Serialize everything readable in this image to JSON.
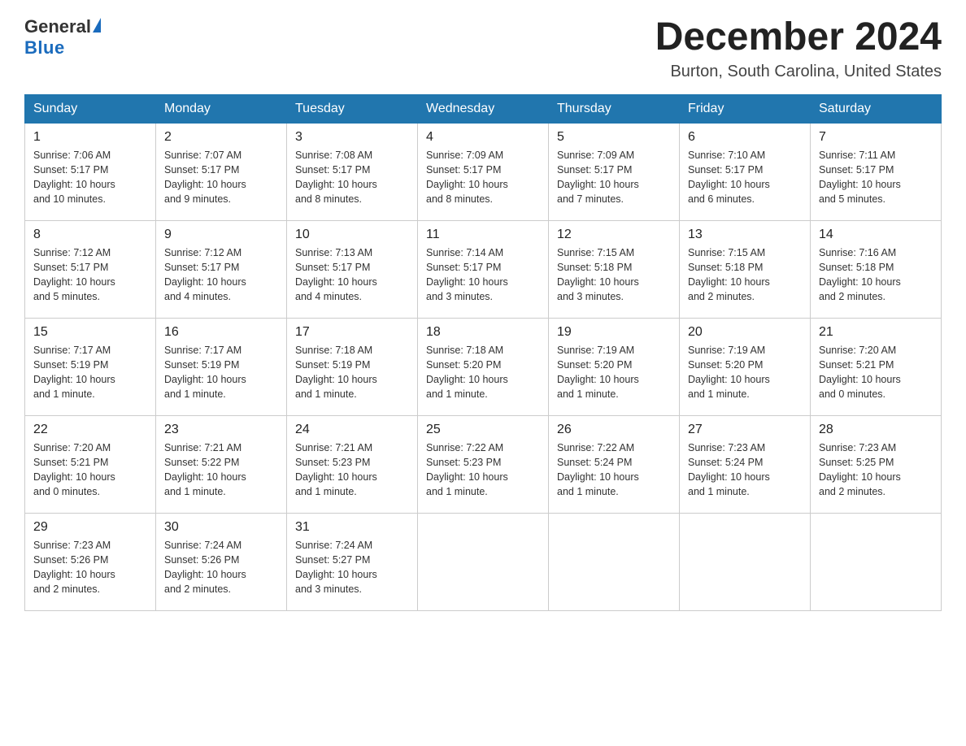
{
  "logo": {
    "general": "General",
    "blue": "Blue"
  },
  "title": {
    "month_year": "December 2024",
    "location": "Burton, South Carolina, United States"
  },
  "headers": [
    "Sunday",
    "Monday",
    "Tuesday",
    "Wednesday",
    "Thursday",
    "Friday",
    "Saturday"
  ],
  "weeks": [
    [
      {
        "day": "1",
        "sunrise": "7:06 AM",
        "sunset": "5:17 PM",
        "daylight": "10 hours and 10 minutes."
      },
      {
        "day": "2",
        "sunrise": "7:07 AM",
        "sunset": "5:17 PM",
        "daylight": "10 hours and 9 minutes."
      },
      {
        "day": "3",
        "sunrise": "7:08 AM",
        "sunset": "5:17 PM",
        "daylight": "10 hours and 8 minutes."
      },
      {
        "day": "4",
        "sunrise": "7:09 AM",
        "sunset": "5:17 PM",
        "daylight": "10 hours and 8 minutes."
      },
      {
        "day": "5",
        "sunrise": "7:09 AM",
        "sunset": "5:17 PM",
        "daylight": "10 hours and 7 minutes."
      },
      {
        "day": "6",
        "sunrise": "7:10 AM",
        "sunset": "5:17 PM",
        "daylight": "10 hours and 6 minutes."
      },
      {
        "day": "7",
        "sunrise": "7:11 AM",
        "sunset": "5:17 PM",
        "daylight": "10 hours and 5 minutes."
      }
    ],
    [
      {
        "day": "8",
        "sunrise": "7:12 AM",
        "sunset": "5:17 PM",
        "daylight": "10 hours and 5 minutes."
      },
      {
        "day": "9",
        "sunrise": "7:12 AM",
        "sunset": "5:17 PM",
        "daylight": "10 hours and 4 minutes."
      },
      {
        "day": "10",
        "sunrise": "7:13 AM",
        "sunset": "5:17 PM",
        "daylight": "10 hours and 4 minutes."
      },
      {
        "day": "11",
        "sunrise": "7:14 AM",
        "sunset": "5:17 PM",
        "daylight": "10 hours and 3 minutes."
      },
      {
        "day": "12",
        "sunrise": "7:15 AM",
        "sunset": "5:18 PM",
        "daylight": "10 hours and 3 minutes."
      },
      {
        "day": "13",
        "sunrise": "7:15 AM",
        "sunset": "5:18 PM",
        "daylight": "10 hours and 2 minutes."
      },
      {
        "day": "14",
        "sunrise": "7:16 AM",
        "sunset": "5:18 PM",
        "daylight": "10 hours and 2 minutes."
      }
    ],
    [
      {
        "day": "15",
        "sunrise": "7:17 AM",
        "sunset": "5:19 PM",
        "daylight": "10 hours and 1 minute."
      },
      {
        "day": "16",
        "sunrise": "7:17 AM",
        "sunset": "5:19 PM",
        "daylight": "10 hours and 1 minute."
      },
      {
        "day": "17",
        "sunrise": "7:18 AM",
        "sunset": "5:19 PM",
        "daylight": "10 hours and 1 minute."
      },
      {
        "day": "18",
        "sunrise": "7:18 AM",
        "sunset": "5:20 PM",
        "daylight": "10 hours and 1 minute."
      },
      {
        "day": "19",
        "sunrise": "7:19 AM",
        "sunset": "5:20 PM",
        "daylight": "10 hours and 1 minute."
      },
      {
        "day": "20",
        "sunrise": "7:19 AM",
        "sunset": "5:20 PM",
        "daylight": "10 hours and 1 minute."
      },
      {
        "day": "21",
        "sunrise": "7:20 AM",
        "sunset": "5:21 PM",
        "daylight": "10 hours and 0 minutes."
      }
    ],
    [
      {
        "day": "22",
        "sunrise": "7:20 AM",
        "sunset": "5:21 PM",
        "daylight": "10 hours and 0 minutes."
      },
      {
        "day": "23",
        "sunrise": "7:21 AM",
        "sunset": "5:22 PM",
        "daylight": "10 hours and 1 minute."
      },
      {
        "day": "24",
        "sunrise": "7:21 AM",
        "sunset": "5:23 PM",
        "daylight": "10 hours and 1 minute."
      },
      {
        "day": "25",
        "sunrise": "7:22 AM",
        "sunset": "5:23 PM",
        "daylight": "10 hours and 1 minute."
      },
      {
        "day": "26",
        "sunrise": "7:22 AM",
        "sunset": "5:24 PM",
        "daylight": "10 hours and 1 minute."
      },
      {
        "day": "27",
        "sunrise": "7:23 AM",
        "sunset": "5:24 PM",
        "daylight": "10 hours and 1 minute."
      },
      {
        "day": "28",
        "sunrise": "7:23 AM",
        "sunset": "5:25 PM",
        "daylight": "10 hours and 2 minutes."
      }
    ],
    [
      {
        "day": "29",
        "sunrise": "7:23 AM",
        "sunset": "5:26 PM",
        "daylight": "10 hours and 2 minutes."
      },
      {
        "day": "30",
        "sunrise": "7:24 AM",
        "sunset": "5:26 PM",
        "daylight": "10 hours and 2 minutes."
      },
      {
        "day": "31",
        "sunrise": "7:24 AM",
        "sunset": "5:27 PM",
        "daylight": "10 hours and 3 minutes."
      },
      null,
      null,
      null,
      null
    ]
  ],
  "labels": {
    "sunrise": "Sunrise:",
    "sunset": "Sunset:",
    "daylight": "Daylight:"
  }
}
